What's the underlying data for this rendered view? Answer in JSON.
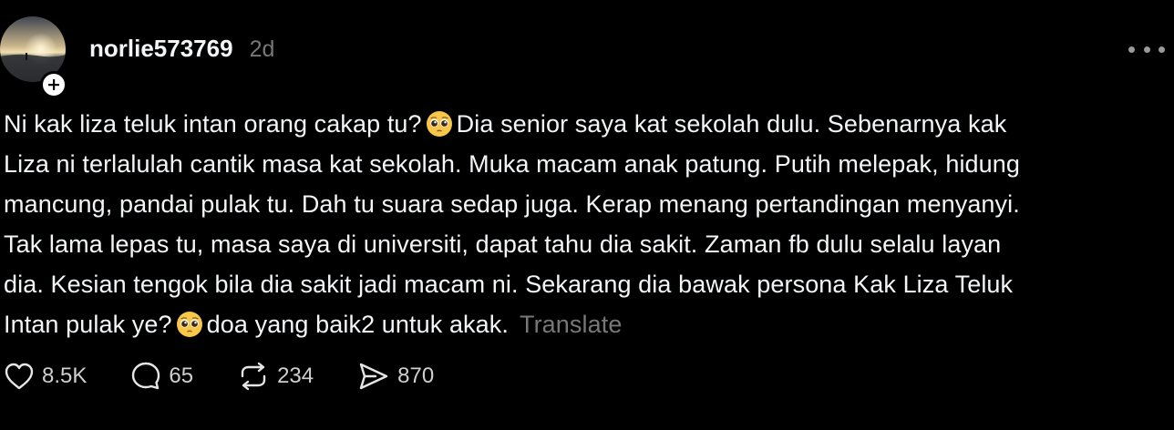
{
  "post": {
    "author": {
      "username": "norlie573769",
      "time_ago": "2d",
      "avatar_icon": "avatar-sunset-beach-photo",
      "follow_icon": "plus-icon"
    },
    "more_icon": "more-horizontal-icon",
    "body_lines": [
      [
        "Ni kak liza teluk intan orang cakap tu? ",
        "pleading-face",
        " Dia senior saya kat sekolah dulu. Sebenarnya kak"
      ],
      [
        "Liza ni terlalulah cantik masa kat sekolah. Muka macam anak patung. Putih melepak, hidung"
      ],
      [
        "mancung, pandai pulak tu. Dah tu suara sedap juga. Kerap menang pertandingan menyanyi."
      ],
      [
        "Tak lama lepas tu, masa saya di universiti, dapat tahu dia sakit. Zaman fb dulu selalu layan"
      ],
      [
        "dia. Kesian tengok bila dia sakit jadi macam ni. Sekarang dia bawak persona Kak Liza Teluk"
      ],
      [
        "Intan pulak ye? ",
        "pleading-face",
        " doa yang baik2 untuk akak."
      ]
    ],
    "line1_a": "Ni kak liza teluk intan orang cakap tu?",
    "line1_b": "Dia senior saya kat sekolah dulu. Sebenarnya kak",
    "line2": "Liza ni terlalulah cantik masa kat sekolah. Muka macam anak patung. Putih melepak, hidung",
    "line3": "mancung, pandai pulak tu. Dah tu suara sedap juga. Kerap menang pertandingan menyanyi.",
    "line4": "Tak lama lepas tu, masa saya di universiti, dapat tahu dia sakit. Zaman fb dulu selalu layan",
    "line5": "dia. Kesian tengok bila dia sakit jadi macam ni. Sekarang dia bawak persona Kak Liza Teluk",
    "line6_a": "Intan pulak ye?",
    "line6_b": "doa yang baik2 untuk akak.",
    "translate_label": "Translate",
    "actions": {
      "like": {
        "icon": "heart-icon",
        "count": "8.5K"
      },
      "reply": {
        "icon": "comment-bubble-icon",
        "count": "65"
      },
      "repost": {
        "icon": "repost-icon",
        "count": "234"
      },
      "share": {
        "icon": "send-icon",
        "count": "870"
      }
    },
    "colors": {
      "background": "#000000",
      "text": "#f3f5f7",
      "muted": "#777777"
    }
  }
}
